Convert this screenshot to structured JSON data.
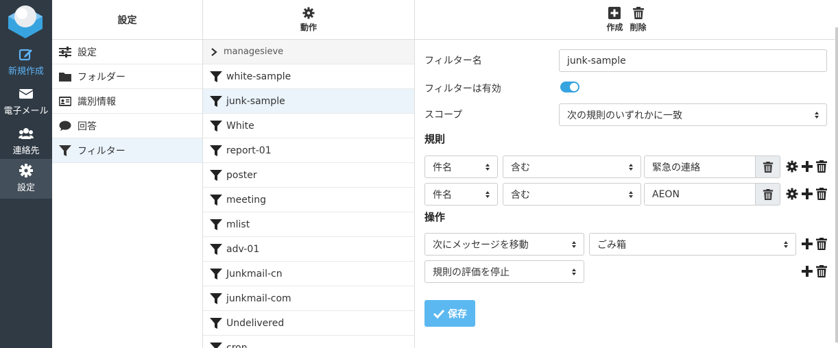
{
  "nav": {
    "compose": "新規作成",
    "mail": "電子メール",
    "contacts": "連絡先",
    "settings": "設定"
  },
  "settings_col": {
    "title": "設定",
    "items": [
      "設定",
      "フォルダー",
      "識別情報",
      "回答",
      "フィルター"
    ]
  },
  "filters_col": {
    "action_label": "動作",
    "group": "managesieve",
    "items": [
      "white-sample",
      "junk-sample",
      "White",
      "report-01",
      "poster",
      "meeting",
      "mlist",
      "adv-01",
      "Junkmail-cn",
      "junkmail-com",
      "Undelivered",
      "cron"
    ]
  },
  "editor": {
    "create_label": "作成",
    "delete_label": "削除",
    "filter_name_label": "フィルター名",
    "filter_name_value": "junk-sample",
    "enabled_label": "フィルターは有効",
    "scope_label": "スコープ",
    "scope_value": "次の規則のいずれかに一致",
    "rules_title": "規則",
    "rules": [
      {
        "field": "件名",
        "op": "含む",
        "value": "緊急の連絡"
      },
      {
        "field": "件名",
        "op": "含む",
        "value": "AEON"
      }
    ],
    "actions_title": "操作",
    "actions": [
      {
        "type": "次にメッセージを移動",
        "target": "ごみ箱"
      },
      {
        "type": "規則の評価を停止"
      }
    ],
    "save_label": "保存"
  },
  "colors": {
    "nav_bg": "#2f3a44",
    "accent": "#37a4e0",
    "selected_row": "#ebf4fb",
    "save_button": "#5cb8f0"
  }
}
